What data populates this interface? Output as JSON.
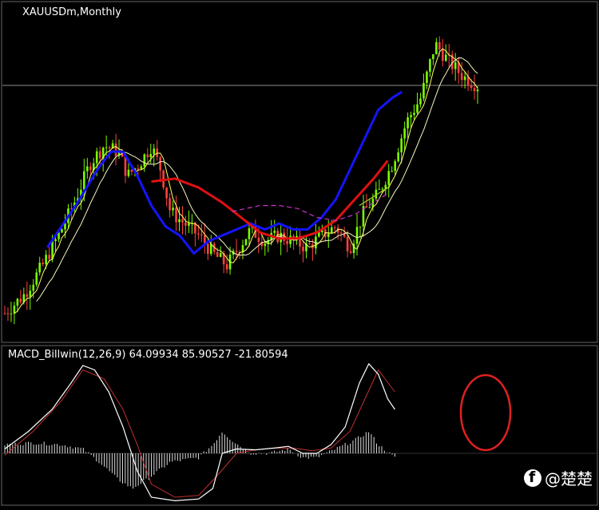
{
  "main_panel": {
    "title": "XAUUSDm,Monthly"
  },
  "macd_panel": {
    "title": "MACD_Billwin(12,26,9) 64.09934 85.90527 -21.80594"
  },
  "watermark": {
    "text": "@楚楚",
    "icon": "facebook-icon"
  },
  "colors": {
    "background": "#000000",
    "bull_candle": "#7CFC00",
    "bear_candle": "#FF4040",
    "fast_ma": "#FFFF66",
    "blue_ma": "#1414FF",
    "red_ma": "#E01010",
    "magenta_ma": "#CC33CC",
    "olive_ma": "#AACC33",
    "white_line": "#FFFFFF",
    "signal_line": "#C03030",
    "annotation_circle": "#E02020"
  },
  "chart_data": [
    {
      "type": "candlestick",
      "title": "XAUUSDm,Monthly",
      "symbol": "XAUUSDm",
      "timeframe": "Monthly",
      "bar_count": 150,
      "price_path": [
        [
          0,
          0.06
        ],
        [
          8,
          0.12
        ],
        [
          16,
          0.22
        ],
        [
          24,
          0.34
        ],
        [
          30,
          0.44
        ],
        [
          36,
          0.56
        ],
        [
          42,
          0.62
        ],
        [
          48,
          0.6
        ],
        [
          52,
          0.52
        ],
        [
          57,
          0.56
        ],
        [
          62,
          0.62
        ],
        [
          66,
          0.54
        ],
        [
          70,
          0.4
        ],
        [
          76,
          0.36
        ],
        [
          82,
          0.32
        ],
        [
          88,
          0.26
        ],
        [
          94,
          0.22
        ],
        [
          99,
          0.28
        ],
        [
          104,
          0.34
        ],
        [
          110,
          0.3
        ],
        [
          116,
          0.32
        ],
        [
          122,
          0.3
        ],
        [
          128,
          0.28
        ],
        [
          134,
          0.32
        ],
        [
          140,
          0.35
        ],
        [
          146,
          0.28
        ],
        [
          152,
          0.4
        ],
        [
          158,
          0.46
        ],
        [
          164,
          0.56
        ],
        [
          170,
          0.7
        ],
        [
          176,
          0.78
        ],
        [
          182,
          0.96
        ],
        [
          188,
          0.9
        ],
        [
          194,
          0.85
        ],
        [
          200,
          0.82
        ]
      ],
      "moving_averages": [
        {
          "color": "blue_ma",
          "path": [
            [
              18,
              0.28
            ],
            [
              30,
              0.42
            ],
            [
              40,
              0.55
            ],
            [
              45,
              0.6
            ],
            [
              50,
              0.6
            ],
            [
              56,
              0.52
            ],
            [
              62,
              0.42
            ],
            [
              68,
              0.35
            ],
            [
              74,
              0.32
            ],
            [
              80,
              0.26
            ],
            [
              86,
              0.3
            ],
            [
              92,
              0.32
            ],
            [
              98,
              0.34
            ],
            [
              104,
              0.36
            ],
            [
              110,
              0.34
            ],
            [
              116,
              0.36
            ],
            [
              122,
              0.34
            ],
            [
              128,
              0.34
            ],
            [
              134,
              0.38
            ],
            [
              140,
              0.44
            ],
            [
              146,
              0.54
            ],
            [
              152,
              0.64
            ],
            [
              158,
              0.74
            ],
            [
              164,
              0.78
            ],
            [
              168,
              0.8
            ]
          ]
        },
        {
          "color": "red_ma",
          "path": [
            [
              62,
              0.5
            ],
            [
              72,
              0.51
            ],
            [
              82,
              0.48
            ],
            [
              92,
              0.43
            ],
            [
              100,
              0.38
            ],
            [
              108,
              0.33
            ],
            [
              116,
              0.31
            ],
            [
              124,
              0.31
            ],
            [
              132,
              0.33
            ],
            [
              140,
              0.37
            ],
            [
              148,
              0.44
            ],
            [
              156,
              0.51
            ],
            [
              162,
              0.57
            ]
          ]
        },
        {
          "color": "magenta_ma",
          "path": [
            [
              96,
              0.4
            ],
            [
              108,
              0.42
            ],
            [
              116,
              0.42
            ],
            [
              124,
              0.41
            ],
            [
              132,
              0.38
            ],
            [
              140,
              0.37
            ],
            [
              148,
              0.39
            ],
            [
              156,
              0.43
            ],
            [
              162,
              0.46
            ]
          ]
        },
        {
          "color": "olive_ma",
          "path": [
            [
              150,
              0.42
            ],
            [
              156,
              0.45
            ],
            [
              162,
              0.48
            ]
          ]
        }
      ]
    },
    {
      "type": "line",
      "title": "MACD_Billwin(12,26,9) 64.09934 85.90527 -21.80594",
      "parameters": [
        12,
        26,
        9
      ],
      "values": {
        "macd": 64.09934,
        "signal": 85.90527,
        "histogram": -21.80594
      },
      "macd_path": [
        [
          0,
          0.05
        ],
        [
          10,
          0.25
        ],
        [
          20,
          0.5
        ],
        [
          28,
          0.8
        ],
        [
          33,
          1.0
        ],
        [
          38,
          0.95
        ],
        [
          44,
          0.7
        ],
        [
          50,
          0.3
        ],
        [
          56,
          -0.2
        ],
        [
          62,
          -0.5
        ],
        [
          72,
          -0.54
        ],
        [
          82,
          -0.52
        ],
        [
          88,
          -0.4
        ],
        [
          92,
          0.0
        ],
        [
          98,
          0.05
        ],
        [
          106,
          0.04
        ],
        [
          114,
          0.06
        ],
        [
          120,
          0.08
        ],
        [
          126,
          0.0
        ],
        [
          132,
          0.0
        ],
        [
          138,
          0.1
        ],
        [
          144,
          0.3
        ],
        [
          150,
          0.8
        ],
        [
          154,
          1.02
        ],
        [
          158,
          0.9
        ],
        [
          162,
          0.62
        ],
        [
          165,
          0.5
        ]
      ],
      "signal_path": [
        [
          0,
          -0.02
        ],
        [
          12,
          0.25
        ],
        [
          24,
          0.6
        ],
        [
          33,
          0.95
        ],
        [
          42,
          0.85
        ],
        [
          50,
          0.5
        ],
        [
          56,
          0.1
        ],
        [
          62,
          -0.35
        ],
        [
          72,
          -0.5
        ],
        [
          82,
          -0.48
        ],
        [
          90,
          -0.25
        ],
        [
          98,
          0.0
        ],
        [
          106,
          0.04
        ],
        [
          114,
          0.06
        ],
        [
          122,
          0.06
        ],
        [
          130,
          0.03
        ],
        [
          138,
          0.06
        ],
        [
          146,
          0.25
        ],
        [
          152,
          0.6
        ],
        [
          158,
          0.95
        ],
        [
          165,
          0.7
        ]
      ],
      "histogram_path": [
        [
          0,
          0.1
        ],
        [
          12,
          0.12
        ],
        [
          24,
          0.1
        ],
        [
          33,
          0.05
        ],
        [
          40,
          -0.1
        ],
        [
          48,
          -0.3
        ],
        [
          54,
          -0.4
        ],
        [
          60,
          -0.3
        ],
        [
          70,
          -0.1
        ],
        [
          82,
          -0.05
        ],
        [
          88,
          0.1
        ],
        [
          92,
          0.25
        ],
        [
          96,
          0.15
        ],
        [
          104,
          0.0
        ],
        [
          112,
          0.0
        ],
        [
          120,
          0.05
        ],
        [
          126,
          -0.05
        ],
        [
          132,
          -0.05
        ],
        [
          140,
          0.05
        ],
        [
          148,
          0.15
        ],
        [
          154,
          0.25
        ],
        [
          158,
          0.1
        ],
        [
          165,
          -0.05
        ]
      ]
    }
  ]
}
